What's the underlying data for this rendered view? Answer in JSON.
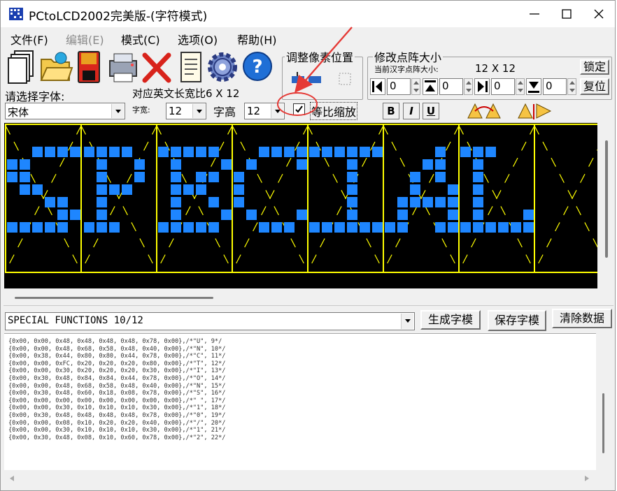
{
  "title": "PCtoLCD2002完美版-(字符模式)",
  "menu": [
    "文件(F)",
    "编辑(E)",
    "模式(C)",
    "选项(O)",
    "帮助(H)"
  ],
  "menu_disabled": [
    false,
    true,
    false,
    false,
    false
  ],
  "toolbar": {
    "choose_font_label": "请选择字体:",
    "font_value": "宋体",
    "ascii_width_label": "对应英文长宽比6 X 12",
    "char_width_label": "字宽:",
    "char_width_value": "12",
    "char_height_label": "字高",
    "char_height_value": "12",
    "scale_checkbox_label": "等比缩放",
    "scale_checked": true,
    "adjust_group_title": "调整像素位置",
    "size_group_title": "修改点阵大小",
    "current_size_label": "当前汉字点阵大小:",
    "current_size_value": "12 X 12",
    "lock_button": "锁定",
    "restore_button": "复位",
    "spin_values": [
      "0",
      "0",
      "0",
      "0"
    ],
    "bold": "B",
    "italic": "I",
    "underline": "U"
  },
  "input": {
    "text": "SPECIAL FUNCTIONS 10/12",
    "generate_button": "生成字模",
    "save_button": "保存字模",
    "clear_button": "清除数据"
  },
  "output_lines": [
    "{0x00, 0x00, 0x48, 0x48, 0x48, 0x48, 0x78, 0x00},/*\"U\", 9*/",
    "{0x00, 0x00, 0x48, 0x68, 0x58, 0x48, 0x40, 0x00},/*\"N\", 10*/",
    "{0x00, 0x38, 0x44, 0x80, 0x80, 0x44, 0x78, 0x00},/*\"C\", 11*/",
    "{0x00, 0x00, 0xFC, 0x20, 0x20, 0x20, 0x80, 0x00},/*\"T\", 12*/",
    "{0x00, 0x00, 0x30, 0x20, 0x20, 0x20, 0x30, 0x00},/*\"I\", 13*/",
    "{0x00, 0x30, 0x48, 0x84, 0x84, 0x44, 0x78, 0x00},/*\"O\", 14*/",
    "{0x00, 0x00, 0x48, 0x68, 0x58, 0x48, 0x40, 0x00},/*\"N\", 15*/",
    "{0x00, 0x30, 0x48, 0x60, 0x18, 0x08, 0x78, 0x00},/*\"S\", 16*/",
    "{0x00, 0x00, 0x00, 0x00, 0x00, 0x00, 0x00, 0x00},/*\" \", 17*/",
    "{0x00, 0x00, 0x30, 0x10, 0x10, 0x10, 0x30, 0x00},/*\"1\", 18*/",
    "{0x00, 0x30, 0x48, 0x48, 0x48, 0x48, 0x78, 0x00},/*\"0\", 19*/",
    "{0x00, 0x00, 0x08, 0x10, 0x20, 0x20, 0x40, 0x00},/*\"/\", 20*/",
    "{0x00, 0x00, 0x30, 0x10, 0x10, 0x10, 0x30, 0x00},/*\"1\", 21*/",
    "{0x00, 0x30, 0x48, 0x08, 0x10, 0x60, 0x78, 0x00},/*\"2\", 22*/"
  ],
  "colors": {
    "pixel_on": "#1e86ff",
    "grid": "#ffff00",
    "canvas_bg": "#000000",
    "annotation": "#e53935"
  },
  "glyph_rows": [
    [
      "..XXXX.",
      ".XXX..X",
      "XXX...X",
      "X..X...",
      "..X..X.",
      "XXXXX..",
      "...X...",
      "X.XX..X",
      "X.XX...",
      "......."
    ],
    [
      "XX.....",
      "..X..XX",
      "..XX..X",
      "X...X..",
      "..X..X.",
      "..X..X.",
      "..X.X..",
      ".XX.XXX",
      "XXX.XX.",
      "......."
    ],
    [
      "..X.X..",
      ".XX.XXX",
      "..X..XX",
      "X...X..",
      "..X.X..",
      "..X.XX.",
      "..X..X.",
      "..X..X.",
      "..X..X.",
      "......."
    ]
  ]
}
